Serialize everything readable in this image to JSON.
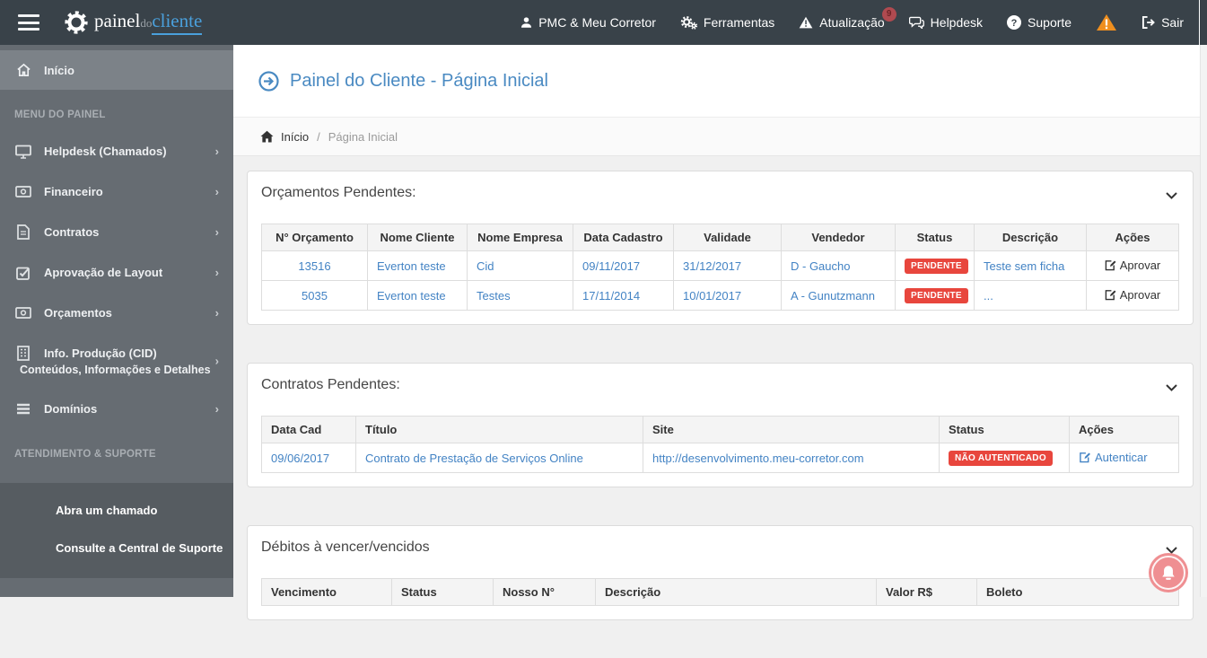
{
  "colors": {
    "navbar_bg": "#394249",
    "sidebar_bg": "#666c72",
    "accent_blue": "#4a8ac2",
    "link_blue": "#4383c4",
    "badge_red": "#e8463d",
    "warning_orange": "#ef8f1f",
    "fab_pink": "#ef8f92"
  },
  "navbar": {
    "brand": {
      "part1": "painel",
      "part2": "do",
      "part3": "cliente"
    },
    "items": [
      {
        "label": "PMC & Meu Corretor",
        "icon": "user-icon"
      },
      {
        "label": "Ferramentas",
        "icon": "gears-icon"
      },
      {
        "label": "Atualização",
        "icon": "warning-triangle-icon",
        "badge": "9"
      },
      {
        "label": "Helpdesk",
        "icon": "chat-icon"
      },
      {
        "label": "Suporte",
        "icon": "question-circle-icon"
      },
      {
        "label": "Sair",
        "icon": "sign-out-icon"
      }
    ]
  },
  "sidebar": {
    "home": {
      "label": "Início"
    },
    "section_menu": "MENU DO PAINEL",
    "items": [
      {
        "label": "Helpdesk (Chamados)",
        "icon": "monitor-icon"
      },
      {
        "label": "Financeiro",
        "icon": "money-icon"
      },
      {
        "label": "Contratos",
        "icon": "file-icon"
      },
      {
        "label": "Aprovação de Layout",
        "icon": "check-square-icon"
      },
      {
        "label": "Orçamentos",
        "icon": "money-icon"
      },
      {
        "label": "Info. Produção (CID)",
        "sublabel": "Conteúdos, Informações e Detalhes",
        "icon": "building-icon"
      },
      {
        "label": "Domínios",
        "icon": "list-icon"
      }
    ],
    "section_support": "ATENDIMENTO & SUPORTE",
    "support_links": [
      {
        "label": "Abra um chamado"
      },
      {
        "label": "Consulte a Central de Suporte"
      }
    ]
  },
  "main": {
    "page_title": "Painel do Cliente - Página Inicial",
    "breadcrumb": {
      "home": "Início",
      "separator": "/",
      "current": "Página Inicial"
    }
  },
  "orcamentos": {
    "title": "Orçamentos Pendentes:",
    "headers": [
      "N° Orçamento",
      "Nome Cliente",
      "Nome Empresa",
      "Data Cadastro",
      "Validade",
      "Vendedor",
      "Status",
      "Descrição",
      "Ações"
    ],
    "rows": [
      {
        "numero": "13516",
        "cliente": "Everton teste",
        "empresa": "Cid",
        "cadastro": "09/11/2017",
        "validade": "31/12/2017",
        "vendedor": "D - Gaucho",
        "status": "PENDENTE",
        "descricao": "Teste sem ficha",
        "acao": "Aprovar"
      },
      {
        "numero": "5035",
        "cliente": "Everton teste",
        "empresa": "Testes",
        "cadastro": "17/11/2014",
        "validade": "10/01/2017",
        "vendedor": "A - Gunutzmann",
        "status": "PENDENTE",
        "descricao": "...",
        "acao": "Aprovar"
      }
    ]
  },
  "contratos": {
    "title": "Contratos Pendentes:",
    "headers": [
      "Data Cad",
      "Título",
      "Site",
      "Status",
      "Ações"
    ],
    "row": {
      "data": "09/06/2017",
      "titulo": "Contrato de Prestação de Serviços Online",
      "site": "http://desenvolvimento.meu-corretor.com",
      "status": "NÃO AUTENTICADO",
      "acao": "Autenticar"
    }
  },
  "debitos": {
    "title": "Débitos à vencer/vencidos",
    "headers": [
      "Vencimento",
      "Status",
      "Nosso N°",
      "Descrição",
      "Valor R$",
      "Boleto"
    ]
  }
}
